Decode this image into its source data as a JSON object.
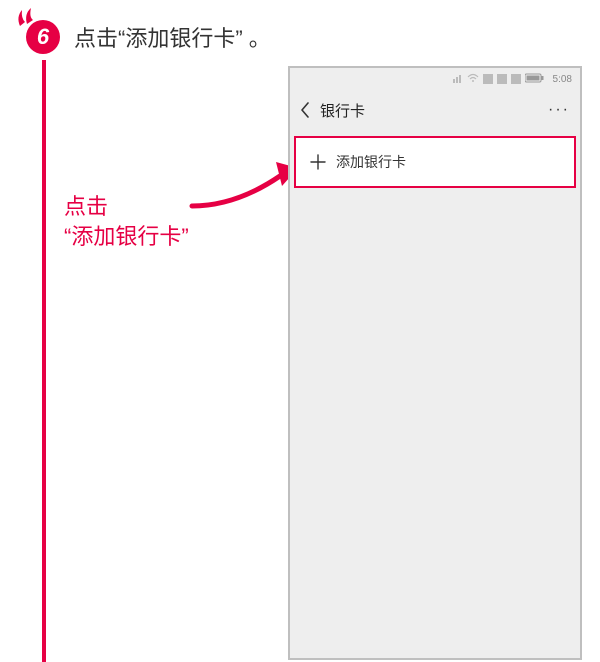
{
  "step": {
    "number": "6",
    "title": "点击“添加银行卡” 。"
  },
  "callout": {
    "line1": "点击",
    "line2": "“添加银行卡”"
  },
  "phone": {
    "statusbar": {
      "time": "5:08"
    },
    "navbar": {
      "title": "银行卡",
      "more": "···"
    },
    "add_card": {
      "label": "添加银行卡"
    }
  },
  "colors": {
    "accent": "#e60044"
  }
}
